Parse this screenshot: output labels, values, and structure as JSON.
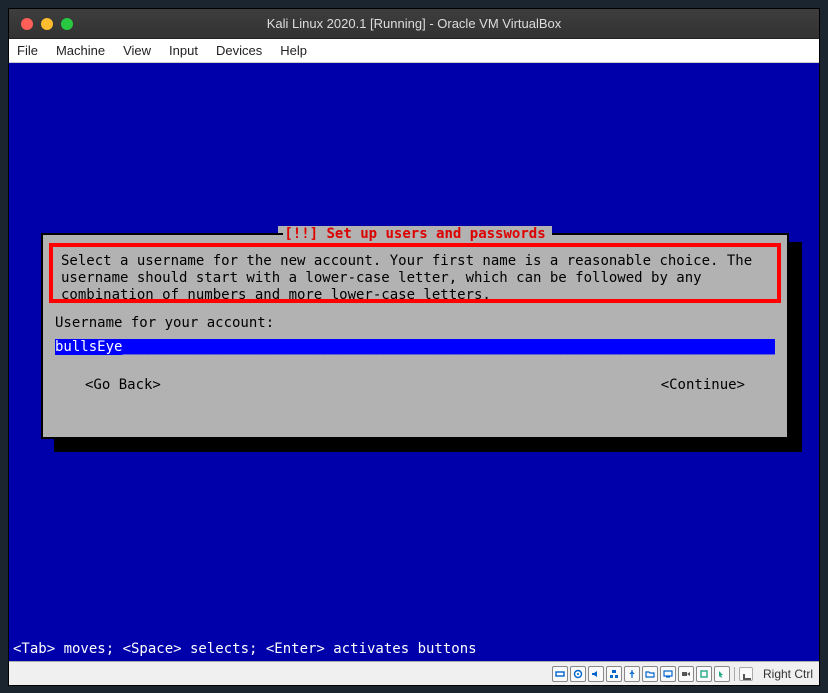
{
  "window": {
    "title": "Kali Linux 2020.1 [Running] - Oracle VM VirtualBox"
  },
  "menubar": {
    "file": "File",
    "machine": "Machine",
    "view": "View",
    "input": "Input",
    "devices": "Devices",
    "help": "Help"
  },
  "dialog": {
    "title": "[!!] Set up users and passwords",
    "body": "Select a username for the new account. Your first name is a reasonable choice. The username should start with a lower-case letter, which can be followed by any combination of numbers and more lower-case letters.",
    "label": "Username for your account:",
    "input_value": "bullsEye",
    "go_back": "<Go Back>",
    "continue": "<Continue>"
  },
  "hints": "<Tab> moves; <Space> selects; <Enter> activates buttons",
  "statusbar": {
    "hostkey": "Right Ctrl"
  },
  "icons": {
    "hdd": "hdd-icon",
    "disc": "disc-icon",
    "net": "network-icon",
    "usb": "usb-icon",
    "shared": "shared-folder-icon",
    "audio": "audio-icon",
    "display": "display-icon",
    "rec": "record-icon",
    "mouse": "mouse-integration-icon",
    "cpu": "cpu-icon"
  }
}
